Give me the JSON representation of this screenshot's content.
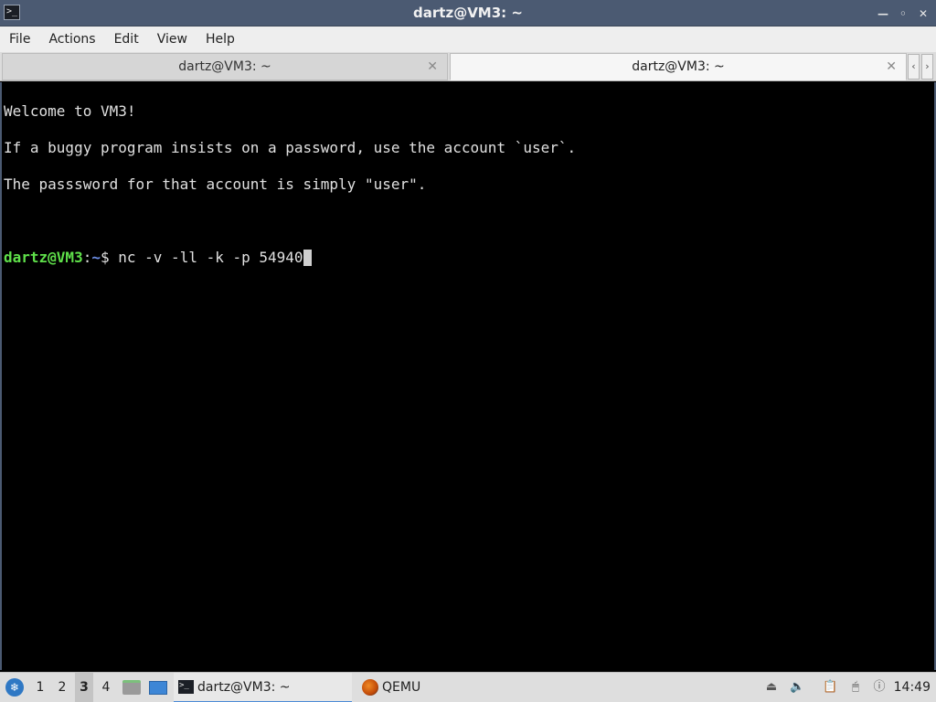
{
  "window": {
    "title": "dartz@VM3: ~",
    "icon": "terminal-icon",
    "buttons": [
      "minimize",
      "maximize",
      "close"
    ]
  },
  "menu": [
    "File",
    "Actions",
    "Edit",
    "View",
    "Help"
  ],
  "tabs": [
    {
      "label": "dartz@VM3: ~",
      "active": false
    },
    {
      "label": "dartz@VM3: ~",
      "active": true
    }
  ],
  "terminal": {
    "lines": [
      "Welcome to VM3!",
      "If a buggy program insists on a password, use the account `user`.",
      "The passsword for that account is simply \"user\"."
    ],
    "prompt": {
      "user_host": "dartz@VM3",
      "colon": ":",
      "path": "~",
      "symbol": "$",
      "command": " nc -v -ll -k -p 54940"
    }
  },
  "taskbar": {
    "workspaces": [
      "1",
      "2",
      "3",
      "4"
    ],
    "active_workspace": "3",
    "tasks": [
      {
        "label": "dartz@VM3: ~",
        "icon": "terminal-icon",
        "active": true
      },
      {
        "label": "QEMU",
        "icon": "qemu-icon",
        "active": false
      }
    ],
    "clock": "14:49"
  },
  "colors": {
    "titlebar": "#4b5a72",
    "prompt_user": "#5fe04a",
    "prompt_path": "#6d8fe8"
  }
}
